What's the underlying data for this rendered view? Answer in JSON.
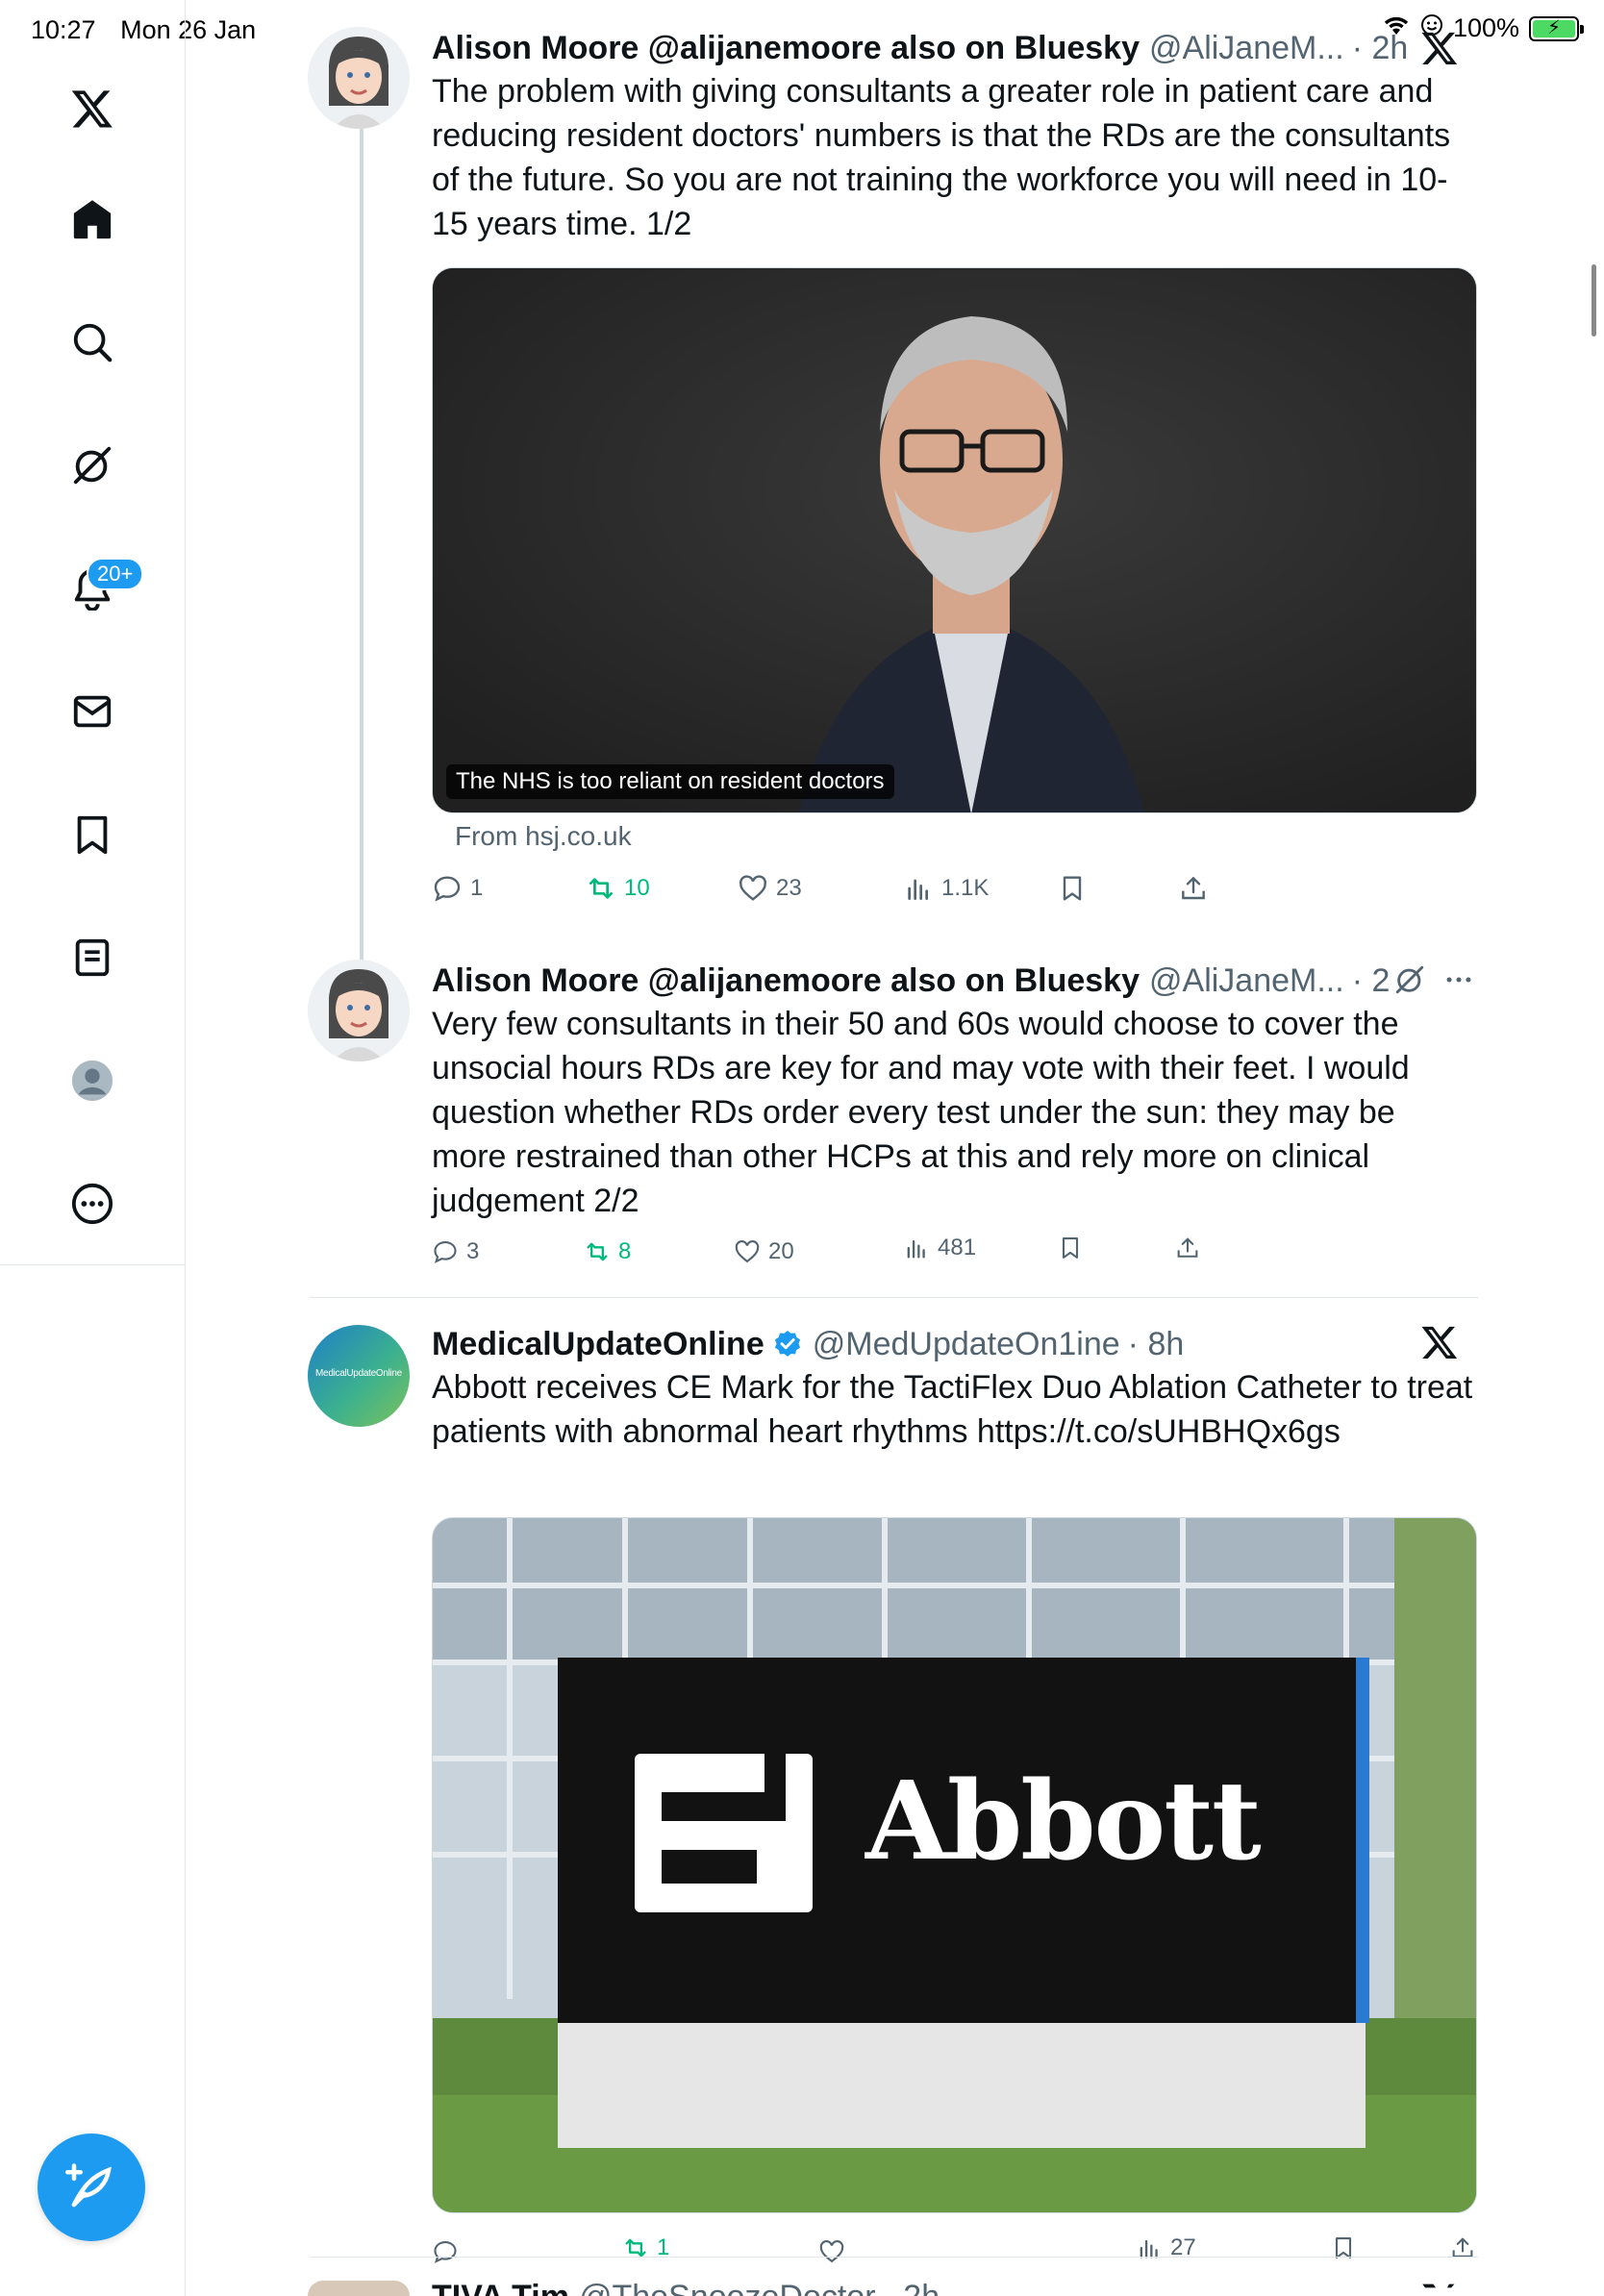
{
  "status_bar": {
    "time": "10:27",
    "date": "Mon 26 Jan",
    "battery_text": "100%",
    "battery_level": 1.0
  },
  "sidebar": {
    "notifications_badge": "20+",
    "items": [
      "x-logo",
      "home",
      "search",
      "grok",
      "notifications",
      "messages",
      "bookmarks",
      "lists",
      "profile",
      "more"
    ]
  },
  "tweets": [
    {
      "name": "Alison Moore @alijanemoore also on Bluesky",
      "handle": "@AliJaneM...",
      "time": "· 2h",
      "text": "The problem with giving consultants a greater role in patient care and reducing resident doctors' numbers is that the RDs are the consultants of the future. So you are not training the workforce you will need in 10-15 years time. 1/2",
      "card_caption": "The NHS is too reliant on resident doctors",
      "card_source": "From hsj.co.uk",
      "replies": "1",
      "retweets": "10",
      "likes": "23",
      "views": "1.1K"
    },
    {
      "name": "Alison Moore @alijanemoore also on Bluesky",
      "handle": "@AliJaneM...",
      "time": "· 2h",
      "text": "Very few consultants in their 50 and 60s would choose to cover the unsocial hours RDs are key for and may vote with their feet. I would question whether RDs order every test under the sun: they may be more restrained than other HCPs at this and rely more on clinical judgement 2/2",
      "replies": "3",
      "retweets": "8",
      "likes": "20",
      "views": "481"
    },
    {
      "name": "MedicalUpdateOnline",
      "handle": "@MedUpdateOn1ine",
      "time": "· 8h",
      "avatar_text": "MedicalUpdateOnline",
      "text": "Abbott receives CE Mark for the TactiFlex Duo Ablation Catheter to treat patients with abnormal heart rhythms https://t.co/sUHBHQx6gs",
      "image_sign_text": "Abbott",
      "replies": "",
      "retweets": "1",
      "likes": "",
      "views": "27"
    },
    {
      "name": "TIVA Tim",
      "handle": "@TheSnoozeDoctor",
      "time": "· 2h"
    }
  ],
  "colors": {
    "accent": "#1d9bf0",
    "retweet": "#00ba7c",
    "muted": "#536471",
    "text": "#0f1419"
  }
}
